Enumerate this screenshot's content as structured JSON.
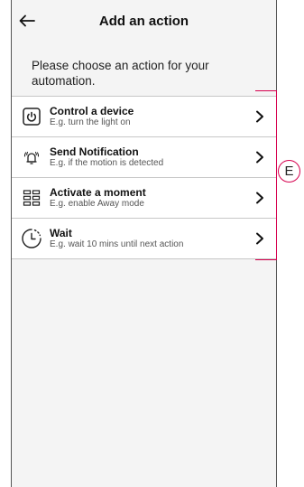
{
  "header": {
    "title": "Add an action",
    "back_icon": "arrow-left-icon"
  },
  "description": "Please choose an action for your automation.",
  "actions": [
    {
      "title": "Control a device",
      "subtitle": "E.g. turn the light on",
      "icon": "power-icon"
    },
    {
      "title": "Send Notification",
      "subtitle": "E.g. if the motion is detected",
      "icon": "bell-icon"
    },
    {
      "title": "Activate a moment",
      "subtitle": "E.g. enable Away mode",
      "icon": "moment-grid-icon"
    },
    {
      "title": "Wait",
      "subtitle": "E.g. wait 10 mins until next action",
      "icon": "timer-icon"
    }
  ],
  "annotation": {
    "label": "E",
    "color": "#d6004e"
  }
}
